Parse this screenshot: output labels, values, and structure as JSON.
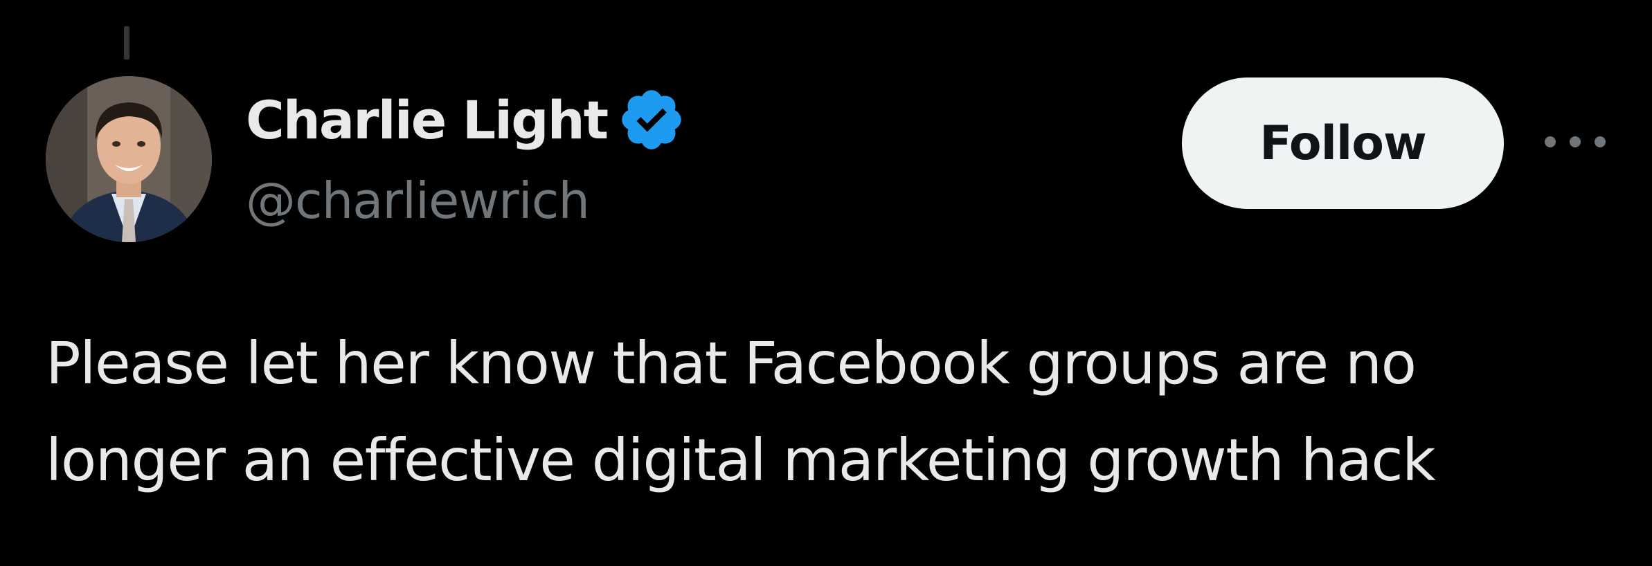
{
  "author": {
    "display_name": "Charlie Light",
    "handle": "@charliewrich",
    "verified": true,
    "verified_color": "#1d9bf0",
    "avatar_icon": "profile-photo"
  },
  "actions": {
    "follow_label": "Follow",
    "more_icon": "more-dots-icon"
  },
  "tweet": {
    "lines": [
      "Please let her know that Facebook groups are no",
      "longer an effective digital marketing growth hack"
    ]
  },
  "colors": {
    "background": "#000000",
    "primary_text": "#e7e9ea",
    "secondary_text": "#71767b",
    "follow_bg": "#eff3f4",
    "follow_text": "#0f1419"
  }
}
